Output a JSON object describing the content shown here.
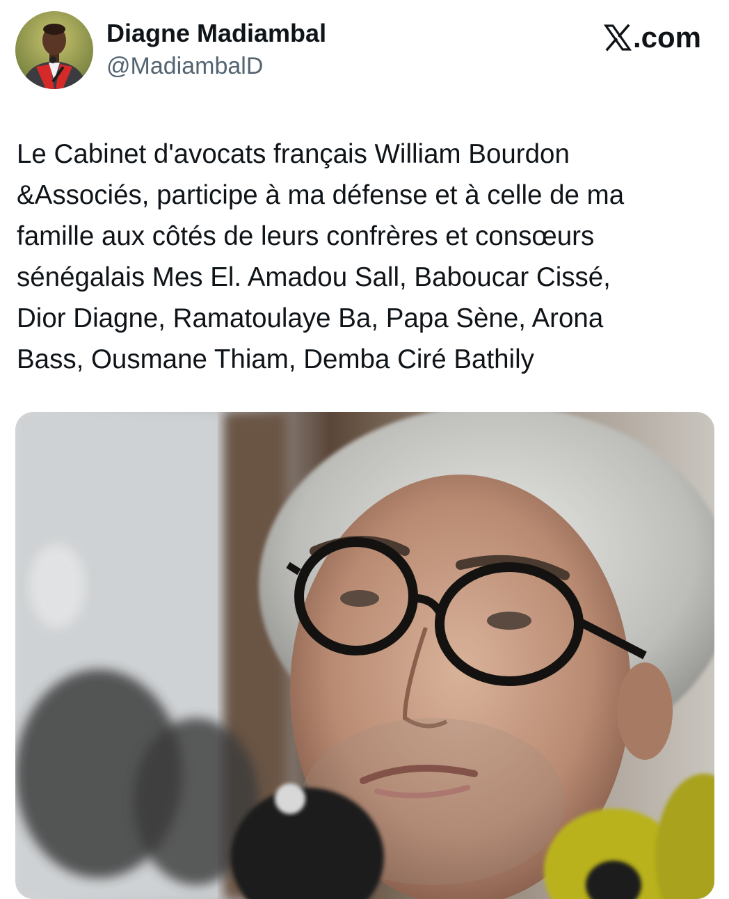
{
  "tweet": {
    "author": {
      "display_name": "Diagne Madiambal",
      "handle": "@MadiambalD",
      "avatar_icon": "profile-photo"
    },
    "brand": {
      "icon": "x-logo-icon",
      "label": ".com"
    },
    "text": "Le Cabinet d'avocats français William Bourdon\n&Associés, participe à ma défense et à celle de ma\nfamille aux côtés de leurs confrères et consœurs\nsénégalais Mes El. Amadou Sall, Baboucar Cissé,\nDior Diagne, Ramatoulaye Ba, Papa Sène, Arona\nBass, Ousmane Thiam, Demba Ciré Bathily",
    "media": {
      "type": "photo"
    }
  },
  "colors": {
    "text_primary": "#0f1419",
    "text_secondary": "#536471",
    "background": "#ffffff"
  }
}
